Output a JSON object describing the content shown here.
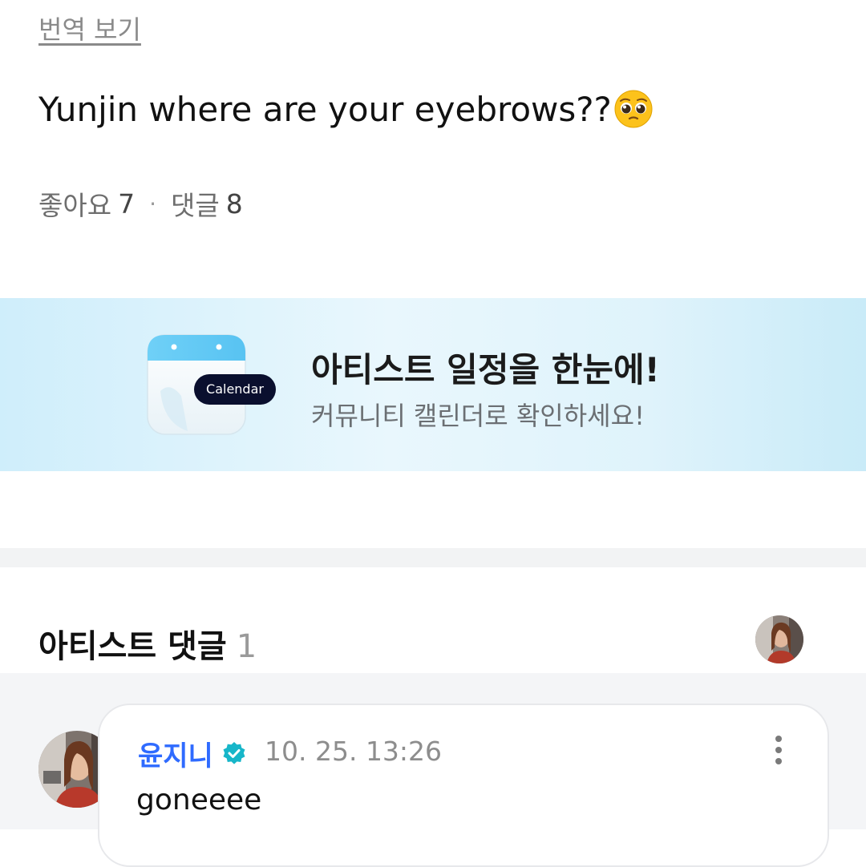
{
  "post": {
    "translate_label": "번역 보기",
    "text": "Yunjin where are your eyebrows??",
    "emoji": "pleading-face-emoji",
    "likes_label": "좋아요",
    "likes_count": "7",
    "separator": "·",
    "comments_label": "댓글",
    "comments_count": "8"
  },
  "banner": {
    "calendar_badge": "Calendar",
    "title": "아티스트 일정을 한눈에!",
    "subtitle": "커뮤니티 캘린더로 확인하세요!"
  },
  "artist_comments": {
    "title": "아티스트 댓글",
    "count": "1",
    "comment": {
      "author": "윤지니",
      "timestamp": "10. 25. 13:26",
      "text": "goneeee"
    }
  },
  "colors": {
    "author_blue": "#2f6bff",
    "verified_teal": "#17b6c9",
    "banner_bg": "#dff3fb"
  }
}
